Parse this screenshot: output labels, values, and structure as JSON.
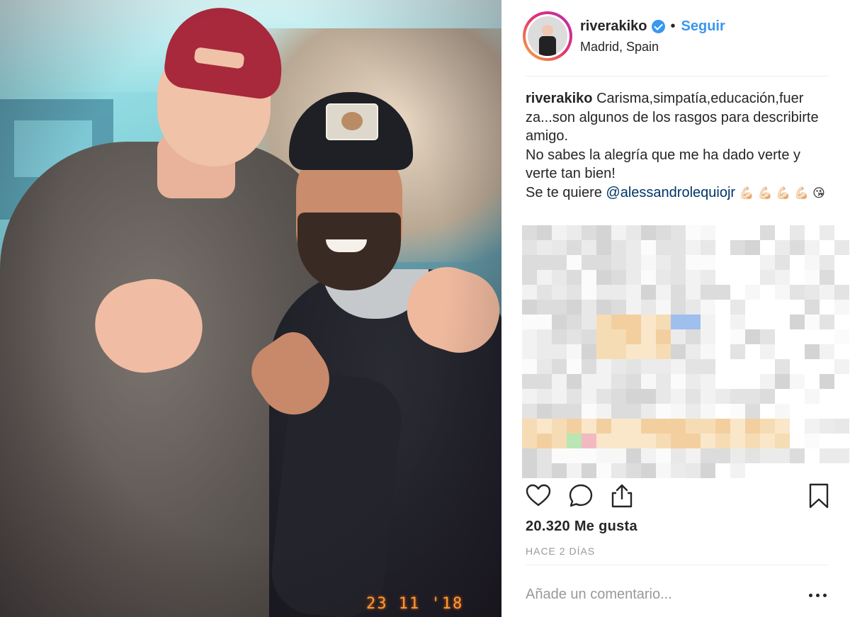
{
  "photo": {
    "datestamp": "23 11 '18"
  },
  "post": {
    "username": "riverakiko",
    "verified": true,
    "follow_label": "Seguir",
    "separator": "•",
    "location": "Madrid, Spain",
    "caption": {
      "username": "riverakiko",
      "line1": "Carisma,simpatía,educación,fuer za...son algunos de los rasgos para describirte amigo.",
      "line2": "No sabes la alegría que me ha dado verte y verte tan bien!",
      "line3_prefix": "Se te quiere ",
      "mention": "@alessandrolequiojr",
      "emojis": "💪🏻 💪🏻 💪🏻 💪🏻 😘"
    },
    "likes": "20.320 Me gusta",
    "time_ago": "HACE 2 DÍAS",
    "comment_placeholder": "Añade un comentario..."
  },
  "icons": {
    "like": "heart-icon",
    "comment": "comment-icon",
    "share": "share-icon",
    "save": "bookmark-icon",
    "more": "more-options-icon",
    "verified": "verified-badge-icon"
  },
  "colors": {
    "link_blue": "#3897f0",
    "mention_blue": "#003569",
    "text": "#262626",
    "muted": "#999999",
    "cap_red": "#a8283c",
    "datestamp_orange": "#ff9a3a"
  }
}
